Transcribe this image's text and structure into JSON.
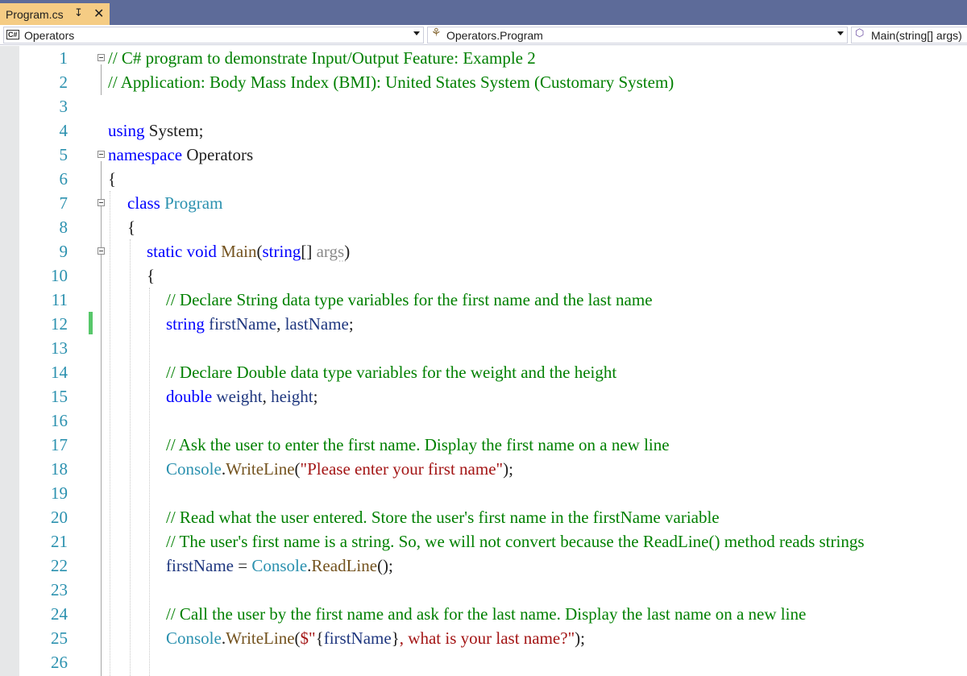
{
  "tab": {
    "title": "Program.cs",
    "pin_icon": "pin-icon",
    "close_icon": "close-icon"
  },
  "navbar": {
    "project": {
      "badge": "C#",
      "label": "Operators",
      "icon": "csharp-project-icon"
    },
    "type": {
      "label": "Operators.Program",
      "icon": "class-icon"
    },
    "member": {
      "label": "Main(string[] args)",
      "icon": "method-icon"
    }
  },
  "editor": {
    "line_numbers": [
      "1",
      "2",
      "3",
      "4",
      "5",
      "6",
      "7",
      "8",
      "9",
      "10",
      "11",
      "12",
      "13",
      "14",
      "15",
      "16",
      "17",
      "18",
      "19",
      "20",
      "21",
      "22",
      "23",
      "24",
      "25",
      "26"
    ],
    "lines": [
      [
        {
          "c": "c",
          "t": "// C# program to demonstrate Input/Output Feature: Example 2"
        }
      ],
      [
        {
          "c": "c",
          "t": "// Application: Body Mass Index (BMI): United States System (Customary System)"
        }
      ],
      [],
      [
        {
          "c": "k",
          "t": "using"
        },
        {
          "c": "p",
          "t": " System;"
        }
      ],
      [
        {
          "c": "k",
          "t": "namespace"
        },
        {
          "c": "p",
          "t": " Operators"
        }
      ],
      [
        {
          "c": "p",
          "t": "{"
        }
      ],
      [
        {
          "c": "k",
          "t": "class"
        },
        {
          "c": "p",
          "t": " "
        },
        {
          "c": "t",
          "t": "Program"
        }
      ],
      [
        {
          "c": "p",
          "t": "{"
        }
      ],
      [
        {
          "c": "k",
          "t": "static"
        },
        {
          "c": "p",
          "t": " "
        },
        {
          "c": "k",
          "t": "void"
        },
        {
          "c": "p",
          "t": " "
        },
        {
          "c": "m",
          "t": "Main"
        },
        {
          "c": "p",
          "t": "("
        },
        {
          "c": "k",
          "t": "string"
        },
        {
          "c": "p",
          "t": "[] "
        },
        {
          "c": "g",
          "t": "args"
        },
        {
          "c": "p",
          "t": ")"
        }
      ],
      [
        {
          "c": "p",
          "t": "{"
        }
      ],
      [
        {
          "c": "c",
          "t": "// Declare String data type variables for the first name and the last name"
        }
      ],
      [
        {
          "c": "k",
          "t": "string"
        },
        {
          "c": "p",
          "t": " "
        },
        {
          "c": "v",
          "t": "firstName"
        },
        {
          "c": "p",
          "t": ", "
        },
        {
          "c": "v",
          "t": "lastName"
        },
        {
          "c": "p",
          "t": ";"
        }
      ],
      [],
      [
        {
          "c": "c",
          "t": "// Declare Double data type variables for the weight and the height"
        }
      ],
      [
        {
          "c": "k",
          "t": "double"
        },
        {
          "c": "p",
          "t": " "
        },
        {
          "c": "v",
          "t": "weight"
        },
        {
          "c": "p",
          "t": ", "
        },
        {
          "c": "v",
          "t": "height"
        },
        {
          "c": "p",
          "t": ";"
        }
      ],
      [],
      [
        {
          "c": "c",
          "t": "// Ask the user to enter the first name. Display the first name on a new line"
        }
      ],
      [
        {
          "c": "t",
          "t": "Console"
        },
        {
          "c": "p",
          "t": "."
        },
        {
          "c": "m",
          "t": "WriteLine"
        },
        {
          "c": "p",
          "t": "("
        },
        {
          "c": "s",
          "t": "\"Please enter your first name\""
        },
        {
          "c": "p",
          "t": ");"
        }
      ],
      [],
      [
        {
          "c": "c",
          "t": "// Read what the user entered. Store the user's first name in the firstName variable"
        }
      ],
      [
        {
          "c": "c",
          "t": "// The user's first name is a string. So, we will not convert because the ReadLine() method reads strings"
        }
      ],
      [
        {
          "c": "v",
          "t": "firstName"
        },
        {
          "c": "p",
          "t": " = "
        },
        {
          "c": "t",
          "t": "Console"
        },
        {
          "c": "p",
          "t": "."
        },
        {
          "c": "m",
          "t": "ReadLine"
        },
        {
          "c": "p",
          "t": "();"
        }
      ],
      [],
      [
        {
          "c": "c",
          "t": "// Call the user by the first name and ask for the last name. Display the last name on a new line"
        }
      ],
      [
        {
          "c": "t",
          "t": "Console"
        },
        {
          "c": "p",
          "t": "."
        },
        {
          "c": "m",
          "t": "WriteLine"
        },
        {
          "c": "p",
          "t": "("
        },
        {
          "c": "s",
          "t": "$\""
        },
        {
          "c": "p",
          "t": "{"
        },
        {
          "c": "v",
          "t": "firstName"
        },
        {
          "c": "p",
          "t": "}"
        },
        {
          "c": "s",
          "t": ", what is your last name?\""
        },
        {
          "c": "p",
          "t": ");"
        }
      ],
      []
    ]
  },
  "colors": {
    "tabstrip": "#5d6b99",
    "active_tab": "#f5cc84",
    "keyword": "#0000ff",
    "type": "#2b91af",
    "comment": "#008000",
    "string": "#a31515",
    "method": "#74531f",
    "variable": "#1f377f",
    "change_marker": "#57c76a"
  }
}
